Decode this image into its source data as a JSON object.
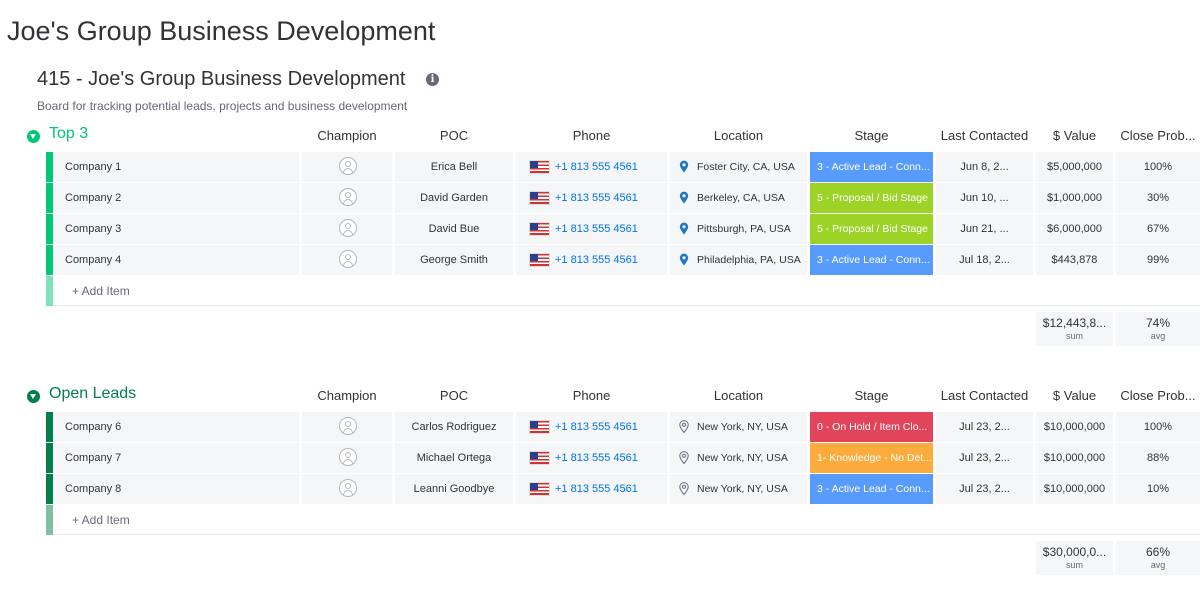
{
  "app": {
    "title": "Joe's Group Business Development"
  },
  "board": {
    "title": "415 - Joe's Group Business Development",
    "description": "Board for tracking potential leads, projects and business development"
  },
  "columns": [
    "Champion",
    "POC",
    "Phone",
    "Location",
    "Stage",
    "Last Contacted",
    "$ Value",
    "Close Prob..."
  ],
  "groups": [
    {
      "title": "Top 3",
      "color": "#00c875",
      "add_label": "+ Add Item",
      "rows": [
        {
          "name": "Company 1",
          "poc": "Erica Bell",
          "phone": "+1 813 555 4561",
          "location": "Foster City, CA, USA",
          "location_pin": "filled",
          "stage": "3 - Active Lead - Conn...",
          "stage_color": "#579bfc",
          "last_contacted": "Jun 8, 2...",
          "value": "$5,000,000",
          "prob": "100%"
        },
        {
          "name": "Company 2",
          "poc": "David Garden",
          "phone": "+1 813 555 4561",
          "location": "Berkeley, CA, USA",
          "location_pin": "filled",
          "stage": "5 - Proposal / Bid Stage",
          "stage_color": "#9cd326",
          "last_contacted": "Jun 10, ...",
          "value": "$1,000,000",
          "prob": "30%"
        },
        {
          "name": "Company 3",
          "poc": "David Bue",
          "phone": "+1 813 555 4561",
          "location": "Pittsburgh, PA, USA",
          "location_pin": "filled",
          "stage": "5 - Proposal / Bid Stage",
          "stage_color": "#9cd326",
          "last_contacted": "Jun 21, ...",
          "value": "$6,000,000",
          "prob": "67%"
        },
        {
          "name": "Company 4",
          "poc": "George Smith",
          "phone": "+1 813 555 4561",
          "location": "Philadelphia, PA, USA",
          "location_pin": "filled",
          "stage": "3 - Active Lead - Conn...",
          "stage_color": "#579bfc",
          "last_contacted": "Jul 18, 2...",
          "value": "$443,878",
          "prob": "99%"
        }
      ],
      "summary": {
        "value": "$12,443,8...",
        "value_label": "sum",
        "prob": "74%",
        "prob_label": "avg"
      }
    },
    {
      "title": "Open Leads",
      "color": "#037f4c",
      "add_label": "+ Add Item",
      "rows": [
        {
          "name": "Company 6",
          "poc": "Carlos Rodriguez",
          "phone": "+1 813 555 4561",
          "location": "New York, NY, USA",
          "location_pin": "outline",
          "stage": "0 - On Hold / Item Clo...",
          "stage_color": "#e2445c",
          "last_contacted": "Jul 23, 2...",
          "value": "$10,000,000",
          "prob": "100%"
        },
        {
          "name": "Company 7",
          "poc": "Michael Ortega",
          "phone": "+1 813 555 4561",
          "location": "New York, NY, USA",
          "location_pin": "outline",
          "stage": "1- Knowledge - No Det...",
          "stage_color": "#fdab3d",
          "last_contacted": "Jul 23, 2...",
          "value": "$10,000,000",
          "prob": "88%"
        },
        {
          "name": "Company 8",
          "poc": "Leanni Goodbye",
          "phone": "+1 813 555 4561",
          "location": "New York, NY, USA",
          "location_pin": "outline",
          "stage": "3 - Active Lead - Conn...",
          "stage_color": "#579bfc",
          "last_contacted": "Jul 23, 2...",
          "value": "$10,000,000",
          "prob": "10%"
        }
      ],
      "summary": {
        "value": "$30,000,0...",
        "value_label": "sum",
        "prob": "66%",
        "prob_label": "avg"
      }
    }
  ]
}
